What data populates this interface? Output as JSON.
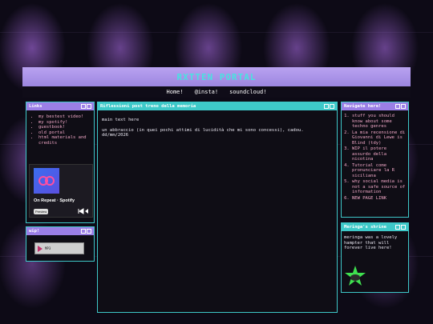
{
  "header": {
    "title": "RXTTEN PORTAL"
  },
  "nav": {
    "items": [
      "Home!",
      "@insta!",
      "soundcloud!"
    ]
  },
  "links_panel": {
    "title": "Links",
    "items": [
      "my bestest video!",
      "my spotify!",
      "guestbook!",
      "old portal",
      "html materials and credits"
    ]
  },
  "spotify": {
    "name": "On Repeat · Spotify",
    "preview": "Preview"
  },
  "wip_panel": {
    "title": "wip!",
    "player_label": "MP3"
  },
  "main_panel": {
    "title": "Riflessioni post treno della memoria",
    "line1": "main text here",
    "line2": "un abbraccio (in quei pochi attimi di lucidità che mi sono concessi), cadou. dd/mm/2026"
  },
  "navigate_panel": {
    "title": "Navigate here!",
    "items": [
      "stuff you should know about some techno genres",
      "La mia recensione di Giovanni di Lewe is Blind (tdy)",
      "WIP il potere assurdo della nicotina",
      "Tutorial come pronunciare la R siciliana",
      "why social media is not a safe source of information",
      "NEW PAGE LINK"
    ]
  },
  "shrine_panel": {
    "title": "Meringa's shrine",
    "text": "meringa was a lovely hampter that will forever live here!"
  },
  "colors": {
    "accent_teal": "#3ec9c9",
    "accent_purple": "#9b7fe6",
    "link_pink": "#f0a7c6",
    "title_cyan": "#48e3e0"
  }
}
